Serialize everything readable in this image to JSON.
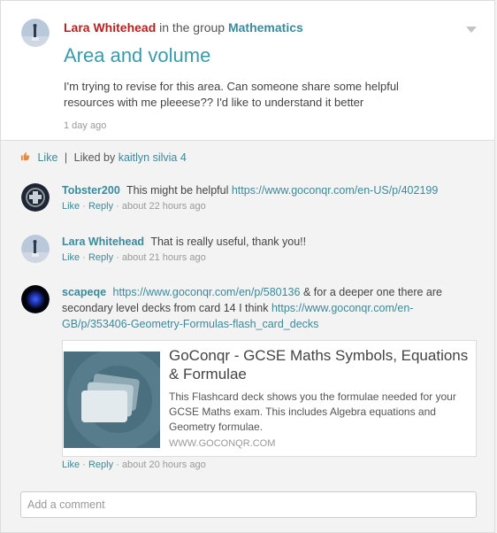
{
  "post": {
    "author": "Lara Whitehead",
    "in_group_text": "in the group",
    "group": "Mathematics",
    "title": "Area and volume",
    "body": "I'm trying to revise for this area. Can someone share some helpful resources with me pleeese?? I'd like to understand it better",
    "time": "1 day ago"
  },
  "likes": {
    "like_label": "Like",
    "separator": "|",
    "liked_by_text": "Liked by",
    "liker": "kaitlyn silvia 4"
  },
  "comments": [
    {
      "author": "Tobster200",
      "text": "This might be helpful",
      "url": "https://www.goconqr.com/en-US/p/402199",
      "like": "Like",
      "dot1": "·",
      "reply": "Reply",
      "dot2": "·",
      "time": "about 22 hours ago"
    },
    {
      "author": "Lara Whitehead",
      "text": "That is really useful, thank you!!",
      "like": "Like",
      "dot1": "·",
      "reply": "Reply",
      "dot2": "·",
      "time": "about 21 hours ago"
    },
    {
      "author": "scapeqe",
      "url": "https://www.goconqr.com/en/p/580136",
      "text_mid": "& for a deeper one there are secondary level decks from card 14 I think",
      "url2": "https://www.goconqr.com/en-GB/p/353406-Geometry-Formulas-flash_card_decks",
      "like": "Like",
      "dot1": "·",
      "reply": "Reply",
      "dot2": "·",
      "time": "about 20 hours ago",
      "preview": {
        "title": "GoConqr - GCSE Maths Symbols, Equations & Formulae",
        "description": "This Flashcard deck shows you the formulae needed for your GCSE Maths exam. This includes Algebra equations and Geometry formulae.",
        "domain": "WWW.GOCONQR.COM"
      }
    }
  ],
  "add_comment": {
    "placeholder": "Add a comment"
  },
  "colors": {
    "author_red": "#b22222",
    "link_teal": "#3a8a9a",
    "title_teal": "#3a9aaa",
    "muted": "#999999"
  },
  "icons": [
    "caret-down-icon",
    "thumbs-up-icon",
    "flashcards-icon"
  ]
}
